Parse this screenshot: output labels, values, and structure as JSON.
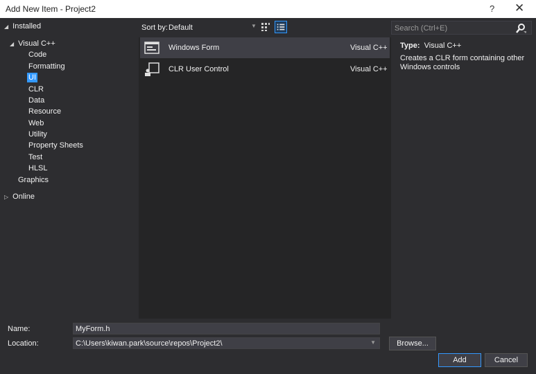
{
  "window": {
    "title": "Add New Item - Project2",
    "help": "?",
    "close": "✕"
  },
  "tree": {
    "installed": "Installed",
    "visual_cpp": "Visual C++",
    "children": [
      "Code",
      "Formatting",
      "UI",
      "CLR",
      "Data",
      "Resource",
      "Web",
      "Utility",
      "Property Sheets",
      "Test",
      "HLSL"
    ],
    "selected": "UI",
    "graphics": "Graphics",
    "online": "Online"
  },
  "toolbar": {
    "sort_label": "Sort by:",
    "sort_value": "Default"
  },
  "templates": [
    {
      "name": "Windows Form",
      "lang": "Visual C++",
      "icon": "windows-form-icon"
    },
    {
      "name": "CLR User Control",
      "lang": "Visual C++",
      "icon": "user-control-icon"
    }
  ],
  "search": {
    "placeholder": "Search (Ctrl+E)"
  },
  "details": {
    "type_label": "Type:",
    "type_value": "Visual C++",
    "description": "Creates a CLR form containing other Windows controls"
  },
  "form": {
    "name_label": "Name:",
    "name_value": "MyForm.h",
    "location_label": "Location:",
    "location_value": "C:\\Users\\kiwan.park\\source\\repos\\Project2\\",
    "browse": "Browse...",
    "add": "Add",
    "cancel": "Cancel"
  },
  "colors": {
    "background": "#2d2d30",
    "list_bg": "#252526",
    "accent": "#3399ff",
    "title_bg": "#ffffff"
  }
}
